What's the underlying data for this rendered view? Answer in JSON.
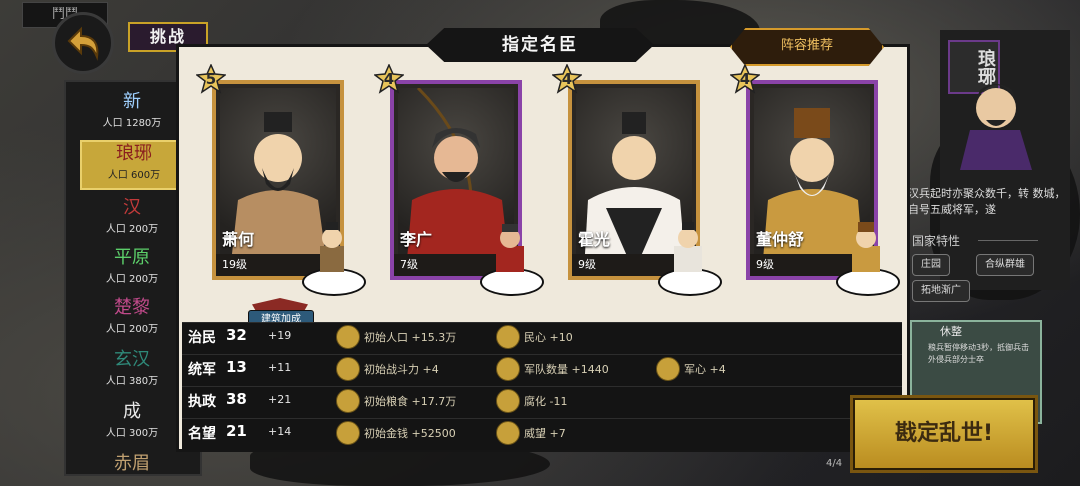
{
  "top_tab": "鬥鬥",
  "challenge_label": "挑战",
  "panel_title": "指定名臣",
  "recommend_label": "阵容推荐",
  "cities": [
    {
      "name": "新",
      "pop": "人口 1280万",
      "color": "#9fd0ff"
    },
    {
      "name": "琅琊",
      "pop": "人口 600万",
      "color": "#8a1e1e",
      "selected": true
    },
    {
      "name": "汉",
      "pop": "人口 200万",
      "color": "#c23a3a"
    },
    {
      "name": "平原",
      "pop": "人口 200万",
      "color": "#5ccf6a"
    },
    {
      "name": "楚黎",
      "pop": "人口 200万",
      "color": "#c04a8a"
    },
    {
      "name": "玄汉",
      "pop": "人口 380万",
      "color": "#2f8a7a"
    },
    {
      "name": "成",
      "pop": "人口 300万",
      "color": "#e8e8e8"
    },
    {
      "name": "赤眉",
      "pop": "",
      "color": "#c0a070"
    }
  ],
  "heroes": [
    {
      "name": "萧何",
      "level": "19级",
      "stars": "5"
    },
    {
      "name": "李广",
      "level": "7级",
      "stars": "4"
    },
    {
      "name": "霍光",
      "level": "9级",
      "stars": "4"
    },
    {
      "name": "董仲舒",
      "level": "9级",
      "stars": "4"
    }
  ],
  "bonus_label": "建筑加成",
  "stats": [
    {
      "label": "治民",
      "value": "32",
      "bonus": "+19",
      "effects": [
        {
          "icon": "people-icon",
          "text": "初始人口  +15.3万"
        },
        {
          "icon": "heart-icon",
          "text": "民心  +10"
        }
      ]
    },
    {
      "label": "统军",
      "value": "13",
      "bonus": "+11",
      "effects": [
        {
          "icon": "sword-icon",
          "text": "初始战斗力  +4"
        },
        {
          "icon": "army-icon",
          "text": "军队数量  +1440"
        },
        {
          "icon": "morale-icon",
          "text": "军心  +4"
        }
      ]
    },
    {
      "label": "执政",
      "value": "38",
      "bonus": "+21",
      "effects": [
        {
          "icon": "grain-icon",
          "text": "初始粮食  +17.7万"
        },
        {
          "icon": "corruption-icon",
          "text": "腐化  -11"
        }
      ]
    },
    {
      "label": "名望",
      "value": "21",
      "bonus": "+14",
      "effects": [
        {
          "icon": "coin-icon",
          "text": "初始金钱  +52500"
        },
        {
          "icon": "prestige-icon",
          "text": "威望  +7"
        }
      ]
    }
  ],
  "right_panel": {
    "title": "琅琊",
    "description": "汉兵起时亦聚众数千，转 数城，自号五威将军，遂",
    "nation_traits_heading": "国家特性",
    "traits": [
      "庄园",
      "合纵群雄",
      "拓地渐广"
    ],
    "event_title": "休整",
    "event_text": "粮兵暂停移动3秒，抵御兵击外侵兵部分士卒"
  },
  "page_indicator": "4/4",
  "decide_label": "戡定乱世!"
}
